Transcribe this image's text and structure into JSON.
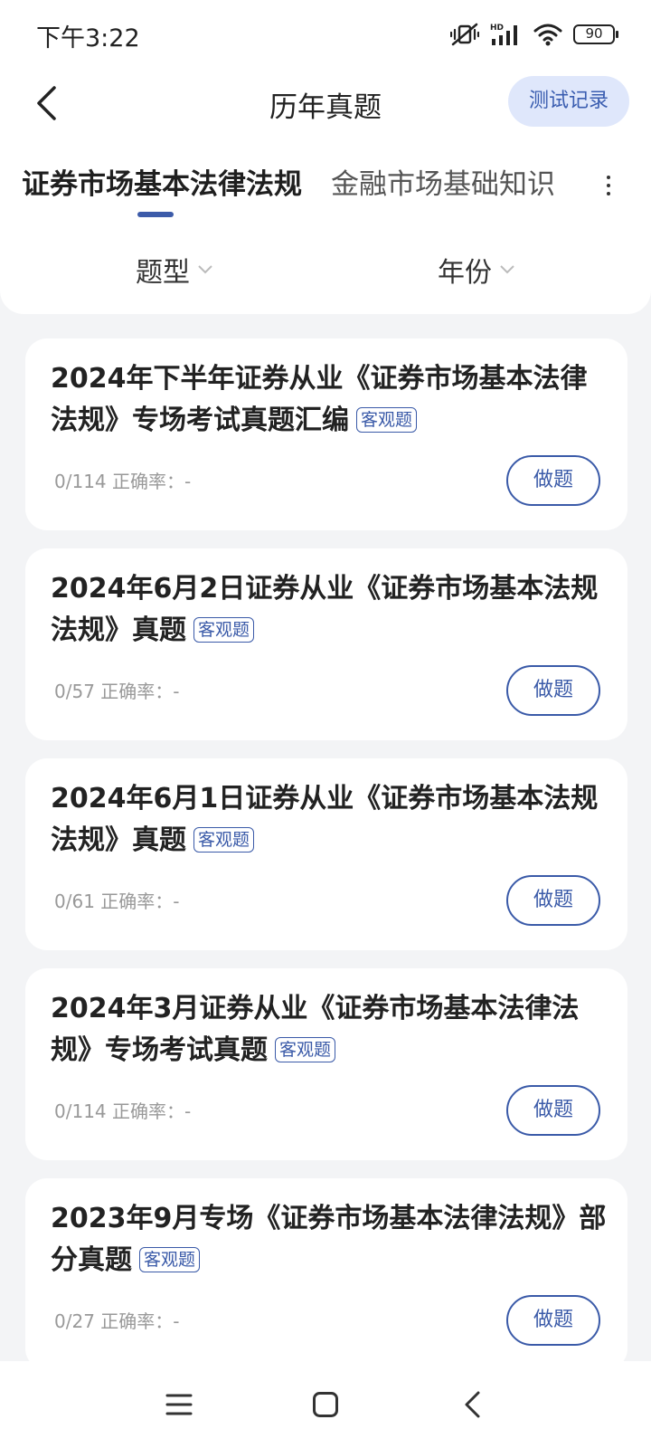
{
  "status_bar": {
    "time": "下午3:22",
    "battery": "90",
    "icons": [
      "mute-vibrate-icon",
      "hd-signal-icon",
      "wifi-icon",
      "battery-icon"
    ]
  },
  "header": {
    "title": "历年真题",
    "record_button": "测试记录",
    "back_icon": "chevron-left-icon"
  },
  "tabs": [
    {
      "label": "证券市场基本法律法规",
      "active": true
    },
    {
      "label": "金融市场基础知识",
      "active": false
    }
  ],
  "filters": {
    "type_label": "题型",
    "year_label": "年份"
  },
  "papers": [
    {
      "title": "2024年下半年证券从业《证券市场基本法律法规》专场考试真题汇编",
      "tag": "客观题",
      "progress": "0/114",
      "accuracy_label": "正确率：",
      "accuracy": "-",
      "action": "做题"
    },
    {
      "title": "2024年6月2日证券从业《证券市场基本法规法规》真题",
      "tag": "客观题",
      "progress": "0/57",
      "accuracy_label": "正确率：",
      "accuracy": "-",
      "action": "做题"
    },
    {
      "title": "2024年6月1日证券从业《证券市场基本法规法规》真题",
      "tag": "客观题",
      "progress": "0/61",
      "accuracy_label": "正确率：",
      "accuracy": "-",
      "action": "做题"
    },
    {
      "title": "2024年3月证券从业《证券市场基本法律法规》专场考试真题",
      "tag": "客观题",
      "progress": "0/114",
      "accuracy_label": "正确率：",
      "accuracy": "-",
      "action": "做题"
    },
    {
      "title": "2023年9月专场《证券市场基本法律法规》部分真题",
      "tag": "客观题",
      "progress": "0/27",
      "accuracy_label": "正确率：",
      "accuracy": "-",
      "action": "做题"
    }
  ],
  "nav_bar": {
    "icons": [
      "menu-icon",
      "home-icon",
      "back-icon"
    ]
  },
  "colors": {
    "accent": "#3a5aa8",
    "record_button_bg": "#dfe7fb",
    "page_bg": "#f3f4f6"
  }
}
